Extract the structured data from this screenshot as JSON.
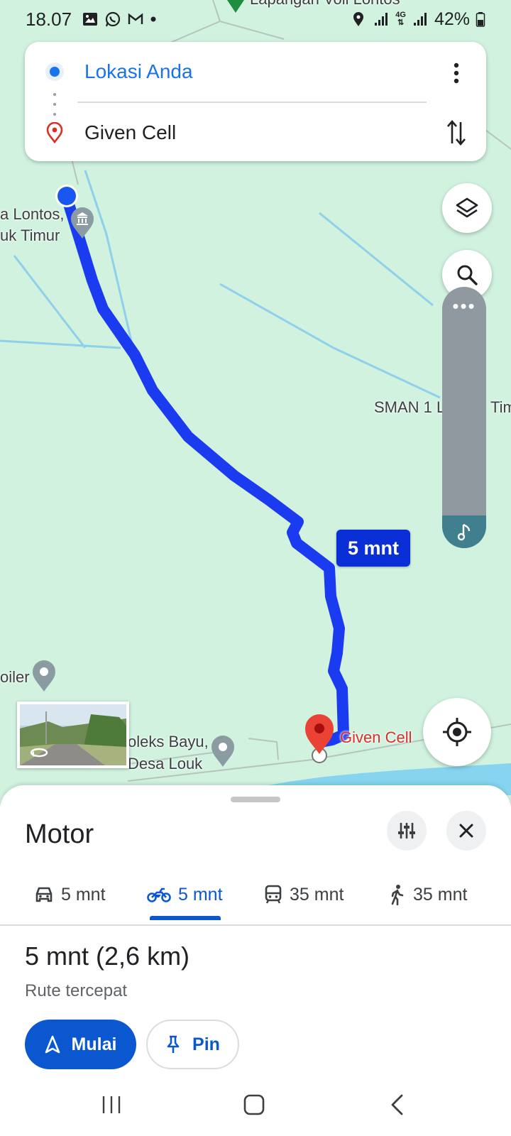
{
  "status_bar": {
    "time": "18.07",
    "network": "4G",
    "battery": "42%"
  },
  "route": {
    "origin": "Lokasi Anda",
    "destination": "Given Cell"
  },
  "map": {
    "labels": {
      "top_cut": "Lapangan Voli Lontos",
      "lontos_line1": "a Lontos,",
      "lontos_line2": "uk Timur",
      "sman": "SMAN 1 L",
      "sman_tail": "Tim",
      "boiler": "oiler",
      "kompleks_line1": "oleks Bayu,",
      "kompleks_line2": "Desa Louk",
      "given_cell": "Given Cell"
    },
    "eta_bubble": "5 mnt",
    "route_color": "#1a3bf0"
  },
  "sheet": {
    "mode_title": "Motor",
    "modes": [
      {
        "icon": "car-icon",
        "label": "5 mnt"
      },
      {
        "icon": "motorcycle-icon",
        "label": "5 mnt"
      },
      {
        "icon": "transit-icon",
        "label": "35 mnt"
      },
      {
        "icon": "walk-icon",
        "label": "35 mnt"
      }
    ],
    "active_mode_index": 1,
    "summary": "5 mnt (2,6 km)",
    "subtitle": "Rute tercepat",
    "start_label": "Mulai",
    "pin_label": "Pin"
  },
  "colors": {
    "accent": "#0b57d0",
    "map_bg": "#d0f2df",
    "destination_red": "#d93025"
  }
}
